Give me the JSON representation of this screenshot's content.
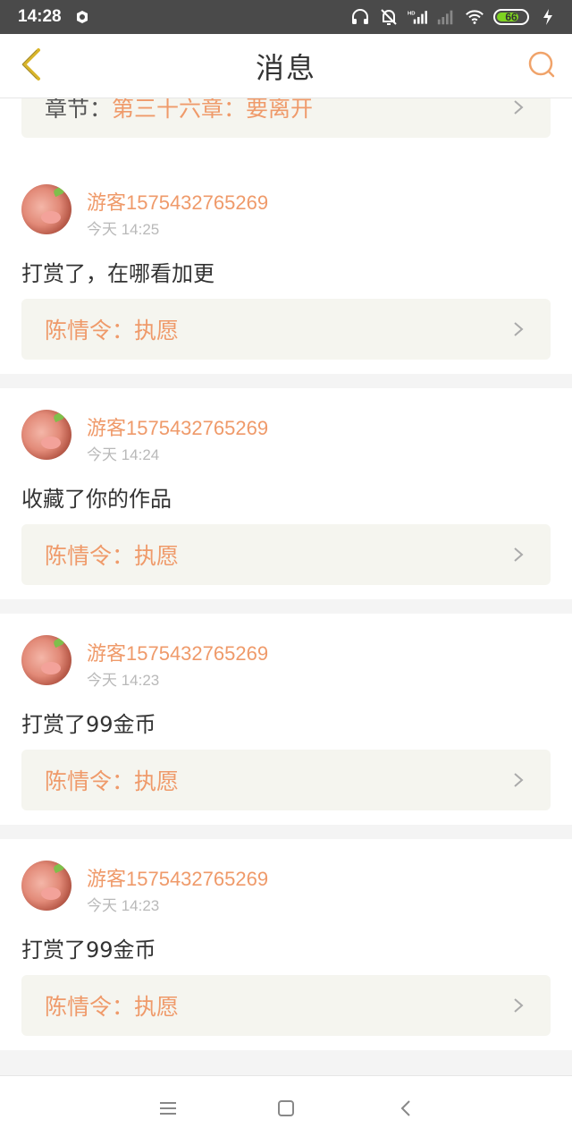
{
  "status_bar": {
    "time": "14:28",
    "battery": "66",
    "icons": [
      "notification-app-icon",
      "headphones-icon",
      "bell-muted-icon",
      "hd-signal-icon",
      "signal-icon",
      "wifi-icon",
      "battery-icon",
      "charging-icon"
    ]
  },
  "header": {
    "title": "消息",
    "back_icon": "chevron-left-icon",
    "search_icon": "search-icon"
  },
  "partial_card": {
    "prefix": "章节：",
    "title": "第三十六章：要离开"
  },
  "cards": [
    {
      "user": "游客1575432765269",
      "time": "今天 14:25",
      "message": "打赏了，在哪看加更",
      "book": "陈情令：执愿"
    },
    {
      "user": "游客1575432765269",
      "time": "今天 14:24",
      "message": "收藏了你的作品",
      "book": "陈情令：执愿"
    },
    {
      "user": "游客1575432765269",
      "time": "今天 14:23",
      "message": "打赏了99金币",
      "book": "陈情令：执愿"
    },
    {
      "user": "游客1575432765269",
      "time": "今天 14:23",
      "message": "打赏了99金币",
      "book": "陈情令：执愿"
    }
  ],
  "nav": {
    "menu_icon": "menu-icon",
    "home_icon": "home-square-icon",
    "back_icon": "back-triangle-icon"
  },
  "colors": {
    "accent": "#ef9a6a",
    "back_arrow": "#d9b52a",
    "status_bar_bg": "#4a4a4a"
  }
}
